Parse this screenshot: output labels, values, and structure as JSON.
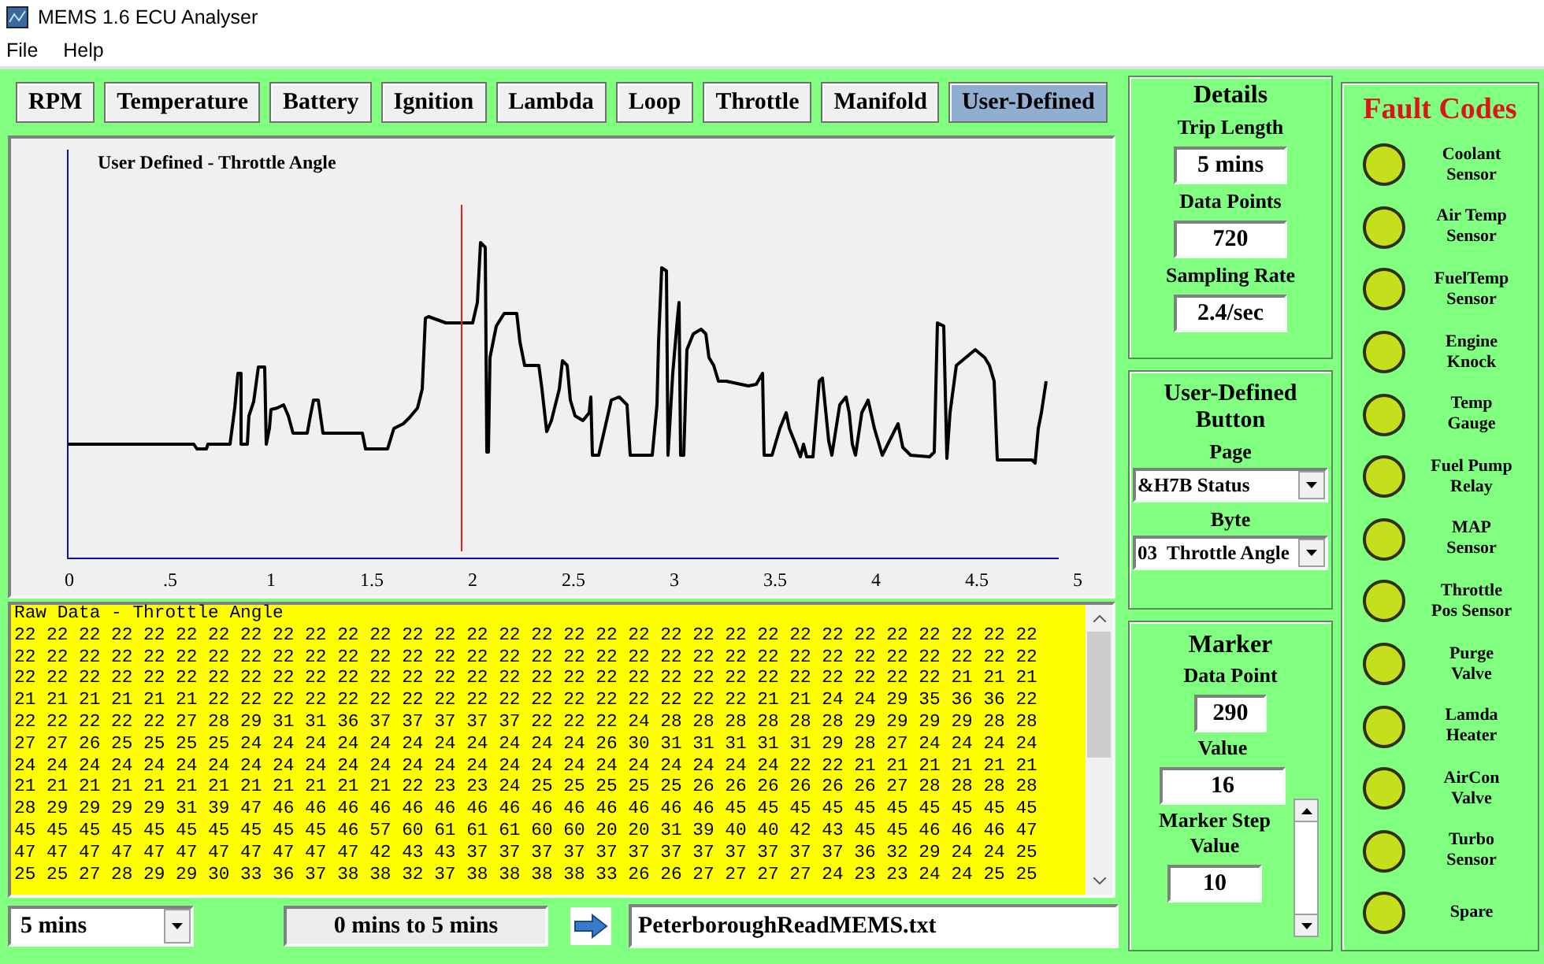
{
  "window": {
    "title": "MEMS 1.6 ECU Analyser"
  },
  "menu": [
    "File",
    "Help"
  ],
  "tabs": [
    {
      "label": "RPM",
      "selected": false
    },
    {
      "label": "Temperature",
      "selected": false
    },
    {
      "label": "Battery",
      "selected": false
    },
    {
      "label": "Ignition",
      "selected": false
    },
    {
      "label": "Lambda",
      "selected": false
    },
    {
      "label": "Loop",
      "selected": false
    },
    {
      "label": "Throttle",
      "selected": false
    },
    {
      "label": "Manifold",
      "selected": false
    },
    {
      "label": "User-Defined",
      "selected": true
    }
  ],
  "chart": {
    "title": "User Defined - Throttle Angle",
    "xticks": [
      "0",
      ".5",
      "1",
      "1.5",
      "2",
      "2.5",
      "3",
      "3.5",
      "4",
      "4.5",
      "5"
    ]
  },
  "raw_data": {
    "title": "Raw Data - Throttle Angle",
    "rows": [
      "22 22 22 22 22 22 22 22 22 22 22 22 22 22 22 22 22 22 22 22 22 22 22 22 22 22 22 22 22 22 22 22",
      "22 22 22 22 22 22 22 22 22 22 22 22 22 22 22 22 22 22 22 22 22 22 22 22 22 22 22 22 22 22 22 22",
      "22 22 22 22 22 22 22 22 22 22 22 22 22 22 22 22 22 22 22 22 22 22 22 22 22 22 22 22 22 21 21 21",
      "21 21 21 21 21 21 22 22 22 22 22 22 22 22 22 22 22 22 22 22 22 22 22 21 21 24 24 29 35 36 36 22",
      "22 22 22 22 22 27 28 29 31 31 36 37 37 37 37 37 22 22 22 24 28 28 28 28 28 28 29 29 29 29 28 28",
      "27 27 26 25 25 25 25 24 24 24 24 24 24 24 24 24 24 24 26 30 31 31 31 31 31 29 28 27 24 24 24 24",
      "24 24 24 24 24 24 24 24 24 24 24 24 24 24 24 24 24 24 24 24 24 24 24 24 22 22 21 21 21 21 21 21",
      "21 21 21 21 21 21 21 21 21 21 21 21 22 23 23 24 25 25 25 25 25 26 26 26 26 26 26 27 28 28 28 28",
      "28 29 29 29 29 31 39 47 46 46 46 46 46 46 46 46 46 46 46 46 46 46 45 45 45 45 45 45 45 45 45 45",
      "45 45 45 45 45 45 45 45 45 45 46 57 60 61 61 61 60 60 20 20 31 39 40 40 42 43 45 45 46 46 46 47",
      "47 47 47 47 47 47 47 47 47 47 47 42 43 43 37 37 37 37 37 37 37 37 37 37 37 37 36 32 29 24 24 25",
      "25 25 27 28 29 29 30 33 36 37 38 38 32 37 38 38 38 38 33 26 26 27 27 27 27 24 23 23 24 24 25 25"
    ]
  },
  "bottom_bar": {
    "duration": "5 mins",
    "range": "0 mins to 5 mins",
    "file": "PeterboroughReadMEMS.txt"
  },
  "details": {
    "title": "Details",
    "fields": [
      {
        "label": "Trip Length",
        "value": "5 mins"
      },
      {
        "label": "Data Points",
        "value": "720"
      },
      {
        "label": "Sampling Rate",
        "value": "2.4/sec"
      }
    ]
  },
  "user_defined": {
    "title": "User-Defined Button",
    "page": {
      "label": "Page",
      "value": "&H7B Status"
    },
    "byte": {
      "label": "Byte",
      "value": "03  Throttle Angle"
    }
  },
  "marker": {
    "title": "Marker",
    "data_point": {
      "label": "Data Point",
      "value": "290"
    },
    "value": {
      "label": "Value",
      "value": "16"
    },
    "step": {
      "label": "Marker Step\nValue",
      "value": "10"
    }
  },
  "fault_codes": {
    "title": "Fault Codes",
    "items": [
      "Coolant\nSensor",
      "Air Temp\nSensor",
      "FuelTemp\nSensor",
      "Engine\nKnock",
      "Temp\nGauge",
      "Fuel Pump\nRelay",
      "MAP\nSensor",
      "Throttle\nPos Sensor",
      "Purge\nValve",
      "Lamda\nHeater",
      "AirCon\nValve",
      "Turbo\nSensor",
      "Spare"
    ]
  }
}
